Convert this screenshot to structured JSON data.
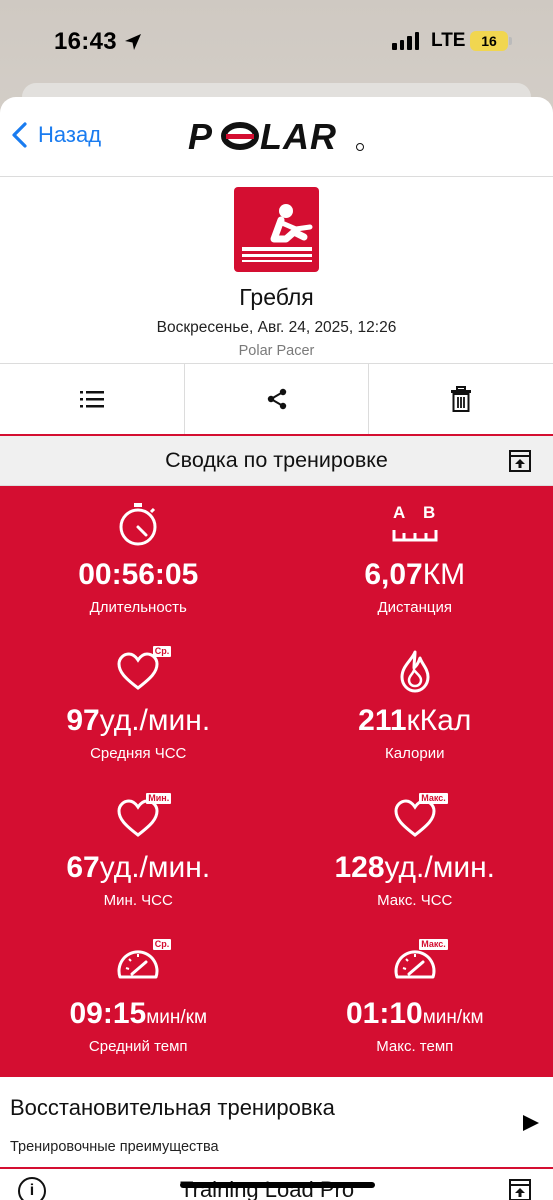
{
  "status_bar": {
    "time": "16:43",
    "network": "LTE",
    "battery": "16"
  },
  "nav": {
    "back_label": "Назад",
    "brand": "POLAR"
  },
  "activity": {
    "sport": "Гребля",
    "date": "Воскресенье, Авг. 24, 2025, 12:26",
    "device": "Polar Pacer"
  },
  "actions": [
    {
      "icon": "list-icon"
    },
    {
      "icon": "share-icon"
    },
    {
      "icon": "trash-icon"
    }
  ],
  "summary": {
    "title": "Сводка по тренировке"
  },
  "stats": {
    "duration": {
      "value": "00:56:05",
      "unit": "",
      "label": "Длительность"
    },
    "distance": {
      "value": "6,07",
      "unit": "КМ",
      "label": "Дистанция",
      "badge_a": "A",
      "badge_b": "B"
    },
    "avg_hr": {
      "value": "97",
      "unit": "уд./мин.",
      "label": "Средняя ЧСС",
      "badge": "Ср."
    },
    "calories": {
      "value": "211",
      "unit": "кКал",
      "label": "Калории"
    },
    "min_hr": {
      "value": "67",
      "unit": "уд./мин.",
      "label": "Мин. ЧСС",
      "badge": "Мин."
    },
    "max_hr": {
      "value": "128",
      "unit": "уд./мин.",
      "label": "Макс. ЧСС",
      "badge": "Макс."
    },
    "avg_pace": {
      "value": "09:15",
      "unit": "мин/км",
      "label": "Средний темп",
      "badge": "Ср."
    },
    "max_pace": {
      "value": "01:10",
      "unit": "мин/км",
      "label": "Макс. темп",
      "badge": "Макс."
    }
  },
  "benefit": {
    "title": "Восстановительная тренировка",
    "subtitle": "Тренировочные преимущества"
  },
  "next_section": {
    "title": "Training Load Pro",
    "info_icon": "i"
  },
  "colors": {
    "polar_red": "#d40e31",
    "link_blue": "#1a7cf0"
  }
}
